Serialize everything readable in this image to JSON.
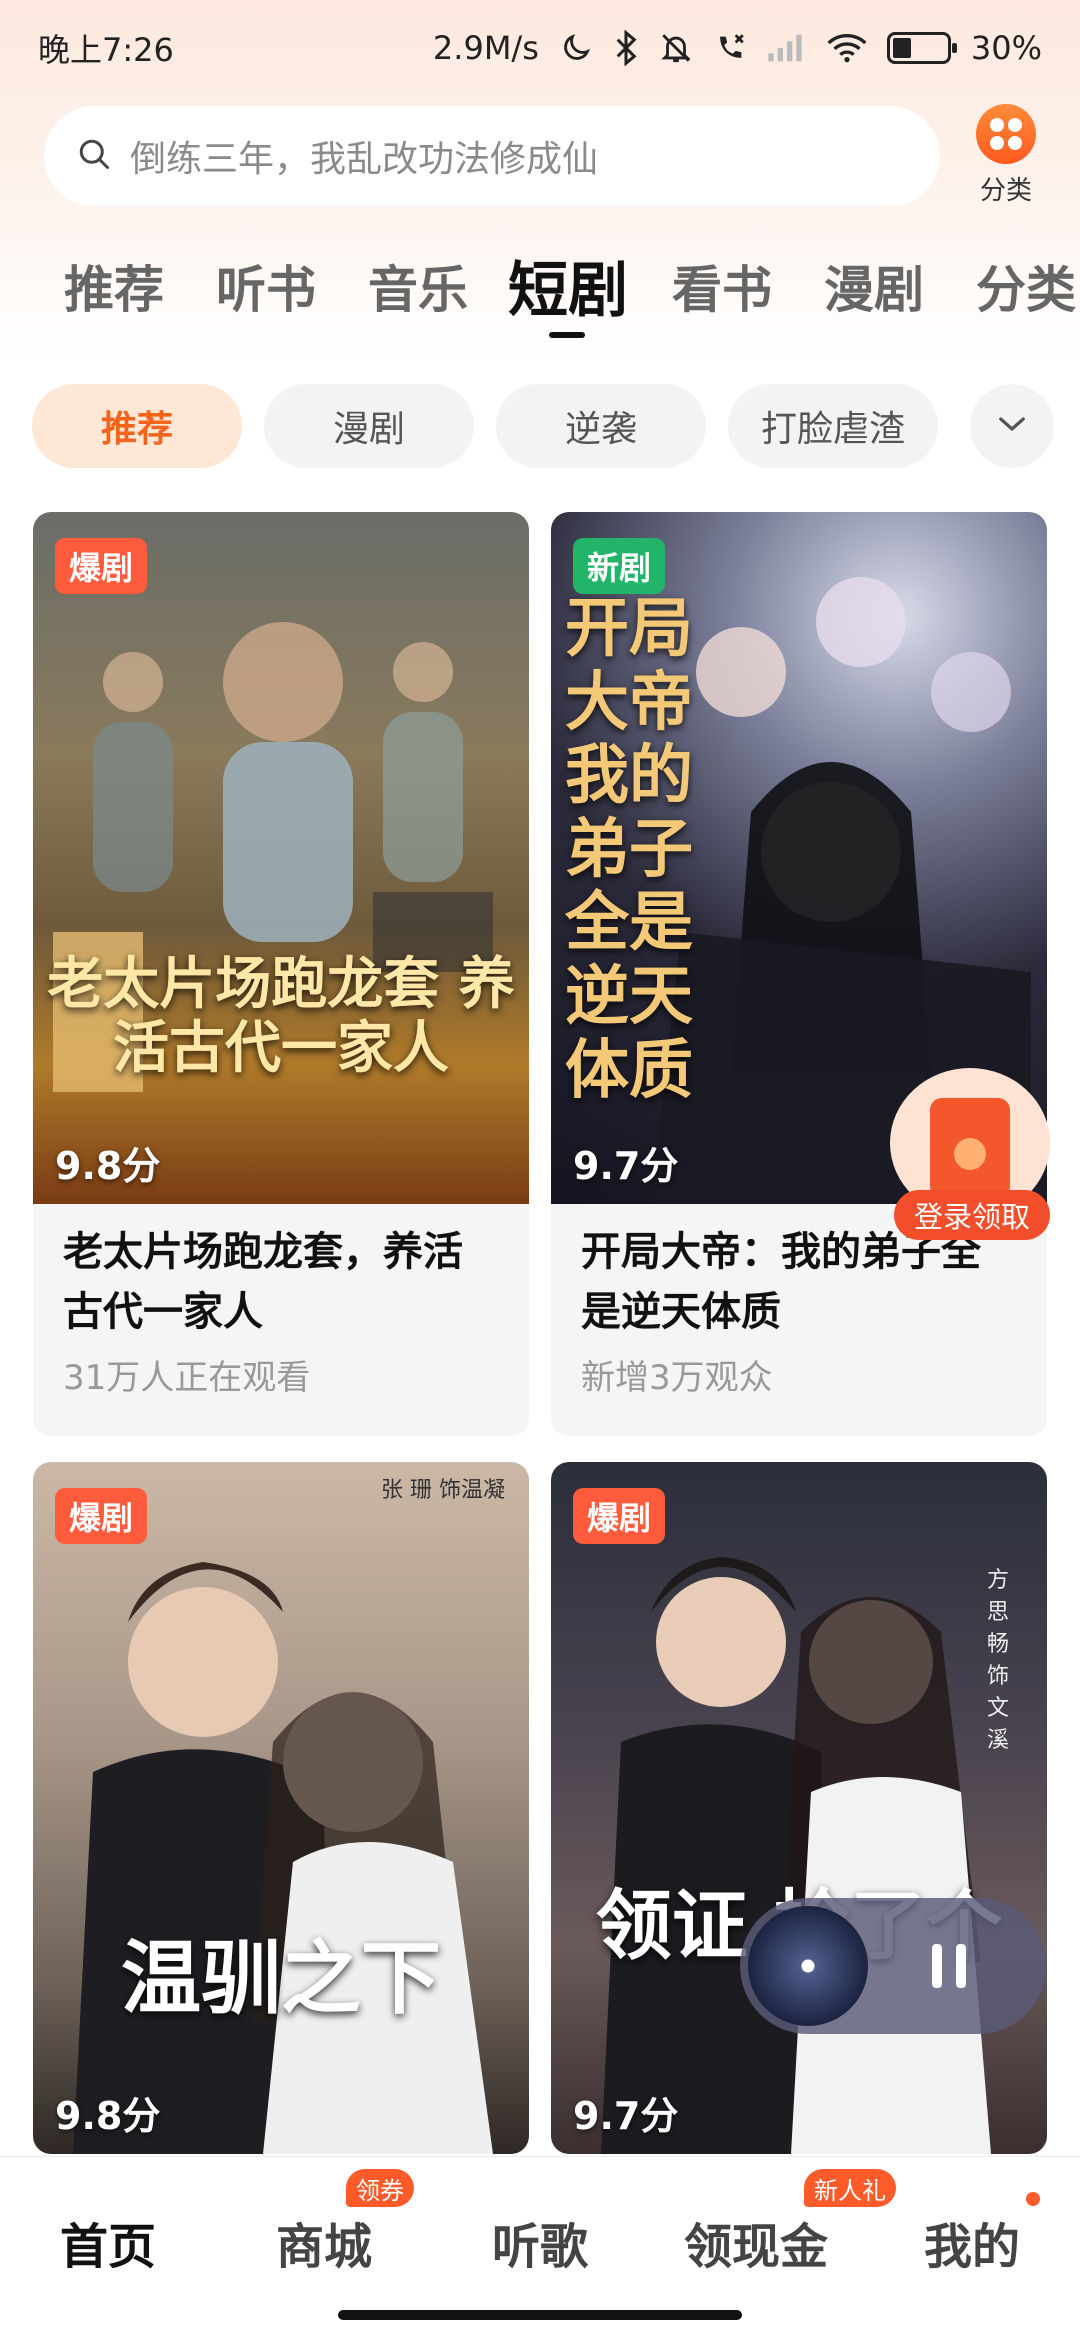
{
  "status_bar": {
    "time": "晚上7:26",
    "network_speed": "2.9M/s",
    "battery": "30%"
  },
  "search": {
    "placeholder": "倒练三年，我乱改功法修成仙"
  },
  "category_button": {
    "label": "分类"
  },
  "main_tabs": [
    {
      "label": "推荐",
      "active": false
    },
    {
      "label": "听书",
      "active": false
    },
    {
      "label": "音乐",
      "active": false
    },
    {
      "label": "短剧",
      "active": true
    },
    {
      "label": "看书",
      "active": false
    },
    {
      "label": "漫剧",
      "active": false
    },
    {
      "label": "分类",
      "active": false
    }
  ],
  "filter_chips": [
    {
      "label": "推荐",
      "active": true
    },
    {
      "label": "漫剧",
      "active": false
    },
    {
      "label": "逆袭",
      "active": false
    },
    {
      "label": "打脸虐渣",
      "active": false
    }
  ],
  "cards": [
    {
      "badge": "爆剧",
      "badge_type": "hot",
      "score": "9.8分",
      "poster_text": "老太片场跑龙套 养活古代一家人",
      "title": "老太片场跑龙套，养活古代一家人",
      "subtitle": "31万人正在观看"
    },
    {
      "badge": "新剧",
      "badge_type": "new",
      "score": "9.7分",
      "poster_text": "开局大帝 我的弟子全是 逆天体质",
      "title": "开局大帝：我的弟子全是逆天体质",
      "subtitle": "新增3万观众"
    },
    {
      "badge": "爆剧",
      "badge_type": "hot",
      "score": "9.8分",
      "poster_text": "温驯之下",
      "poster_sub": "张 珊 饰温凝"
    },
    {
      "badge": "爆剧",
      "badge_type": "hot",
      "score": "9.7分",
      "poster_text": "领证 捡了个",
      "poster_sub": "方思畅 饰 文溪"
    }
  ],
  "red_packet": {
    "label": "登录领取"
  },
  "bottom_nav": [
    {
      "label": "首页",
      "active": true
    },
    {
      "label": "商城",
      "badge": "领券"
    },
    {
      "label": "听歌"
    },
    {
      "label": "领现金",
      "badge": "新人礼"
    },
    {
      "label": "我的"
    }
  ]
}
